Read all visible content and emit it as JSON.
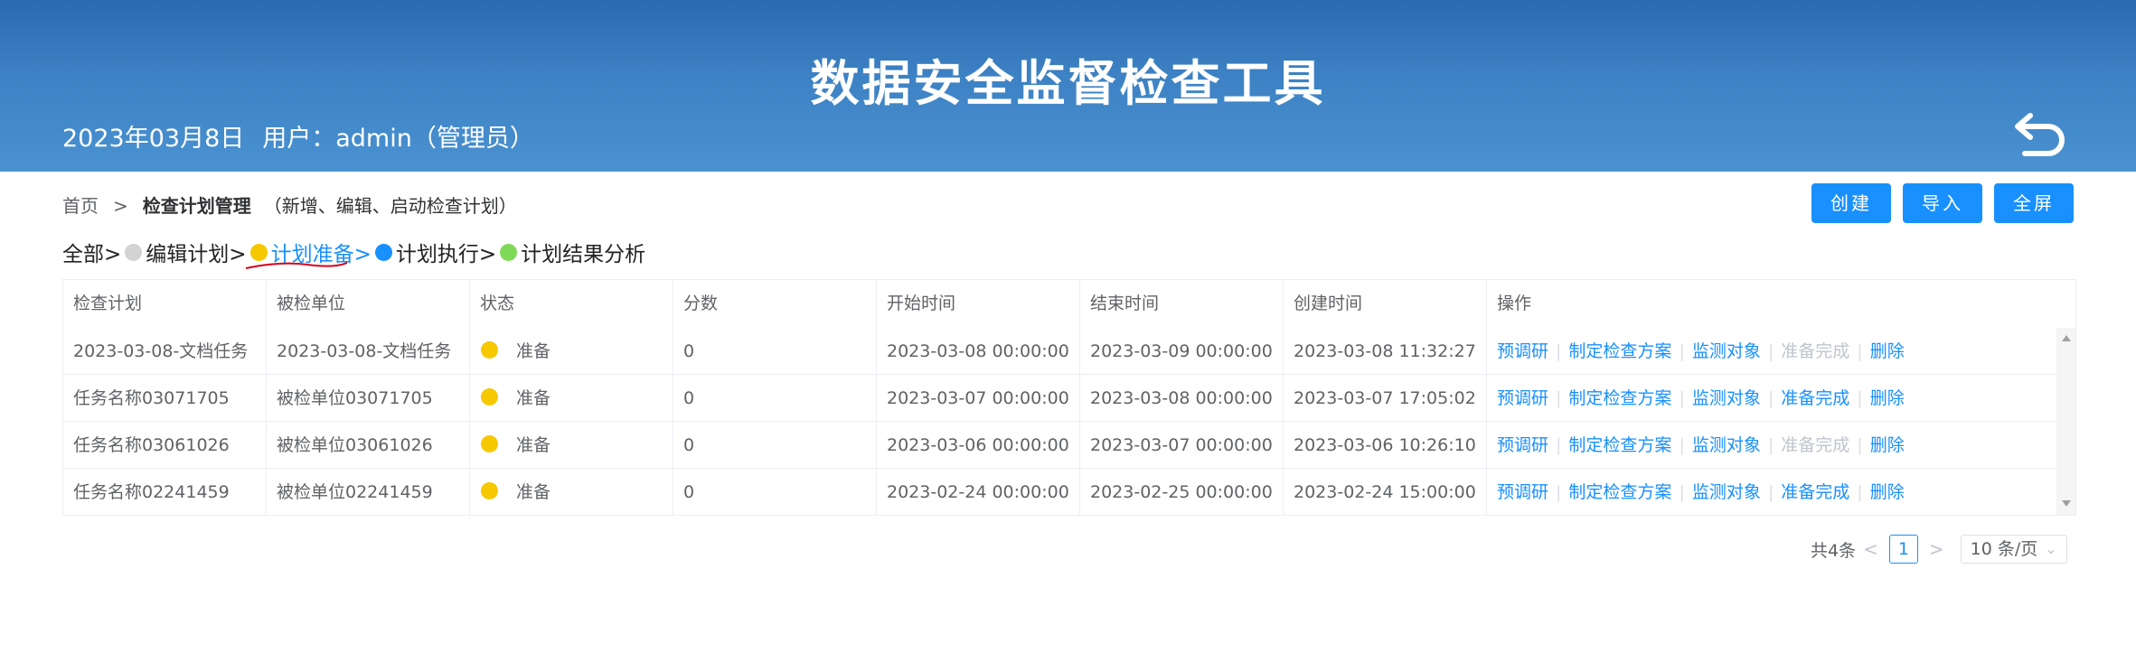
{
  "header": {
    "title": "数据安全监督检查工具",
    "date": "2023年03月8日",
    "user": "用户：admin（管理员）"
  },
  "breadcrumb": {
    "home": "首页",
    "separator": ">",
    "current": "检查计划管理",
    "note": "（新增、编辑、启动检查计划）"
  },
  "actions": {
    "create": "创建",
    "import": "导入",
    "fullscreen": "全屏"
  },
  "filter": {
    "all": "全部>",
    "items": [
      {
        "label": "编辑计划>",
        "color": "#d3d3d3"
      },
      {
        "label": "计划准备>",
        "color": "#f5c800"
      },
      {
        "label": "计划执行>",
        "color": "#1890ff"
      },
      {
        "label": "计划结果分析",
        "color": "#7ed957"
      }
    ]
  },
  "table": {
    "columns": [
      "检查计划",
      "被检单位",
      "状态",
      "分数",
      "开始时间",
      "结束时间",
      "创建时间",
      "操作"
    ],
    "rows": [
      {
        "plan": "2023-03-08-文档任务",
        "unit": "2023-03-08-文档任务",
        "status": "准备",
        "score": "0",
        "start": "2023-03-08 00:00:00",
        "end": "2023-03-09 00:00:00",
        "created": "2023-03-08 11:32:27",
        "ops": [
          "预调研",
          "制定检查方案",
          "监测对象",
          "准备完成",
          "删除"
        ],
        "complete_enabled": false
      },
      {
        "plan": "任务名称03071705",
        "unit": "被检单位03071705",
        "status": "准备",
        "score": "0",
        "start": "2023-03-07 00:00:00",
        "end": "2023-03-08 00:00:00",
        "created": "2023-03-07 17:05:02",
        "ops": [
          "预调研",
          "制定检查方案",
          "监测对象",
          "准备完成",
          "删除"
        ],
        "complete_enabled": true
      },
      {
        "plan": "任务名称03061026",
        "unit": "被检单位03061026",
        "status": "准备",
        "score": "0",
        "start": "2023-03-06 00:00:00",
        "end": "2023-03-07 00:00:00",
        "created": "2023-03-06 10:26:10",
        "ops": [
          "预调研",
          "制定检查方案",
          "监测对象",
          "准备完成",
          "删除"
        ],
        "complete_enabled": false
      },
      {
        "plan": "任务名称02241459",
        "unit": "被检单位02241459",
        "status": "准备",
        "score": "0",
        "start": "2023-02-24 00:00:00",
        "end": "2023-02-25 00:00:00",
        "created": "2023-02-24 15:00:00",
        "ops": [
          "预调研",
          "制定检查方案",
          "监测对象",
          "准备完成",
          "删除"
        ],
        "complete_enabled": true
      }
    ],
    "status_color": "#f5c800"
  },
  "pagination": {
    "total": "共4条",
    "current_page": "1",
    "page_size": "10 条/页"
  }
}
